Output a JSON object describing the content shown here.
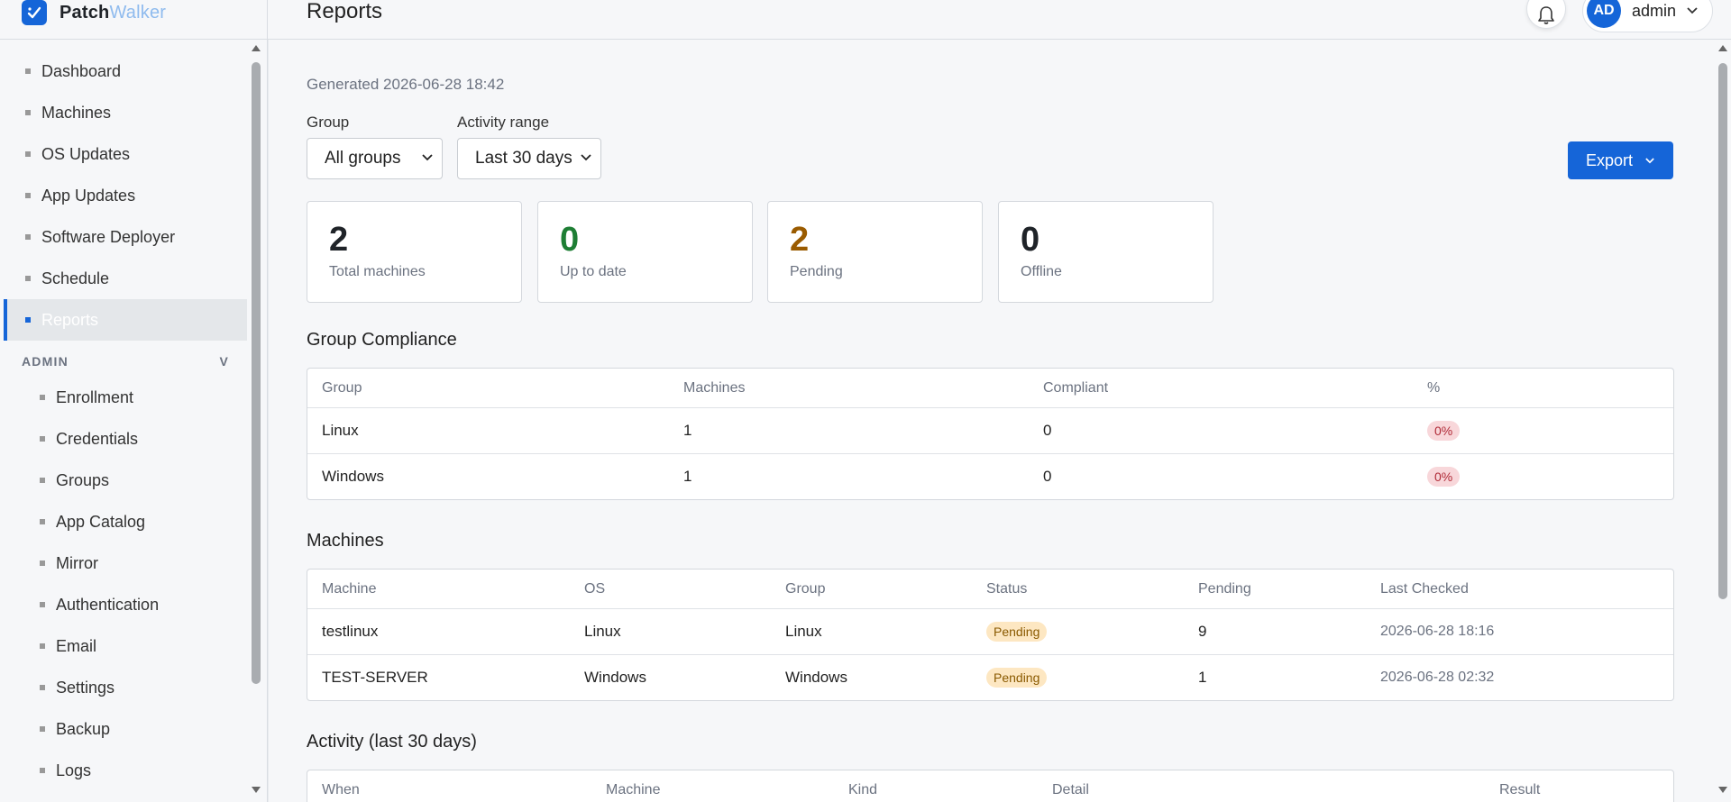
{
  "brand": {
    "part1": "Patch",
    "part2": "Walker"
  },
  "page": {
    "title": "Reports"
  },
  "header": {
    "avatar_initials": "AD",
    "user_name": "admin"
  },
  "sidebar": {
    "items": [
      {
        "label": "Dashboard"
      },
      {
        "label": "Machines"
      },
      {
        "label": "OS Updates"
      },
      {
        "label": "App Updates"
      },
      {
        "label": "Software Deployer"
      },
      {
        "label": "Schedule"
      },
      {
        "label": "Reports"
      }
    ],
    "admin_header": "ADMIN",
    "admin_toggle": "V",
    "admin_items": [
      {
        "label": "Enrollment"
      },
      {
        "label": "Credentials"
      },
      {
        "label": "Groups"
      },
      {
        "label": "App Catalog"
      },
      {
        "label": "Mirror"
      },
      {
        "label": "Authentication"
      },
      {
        "label": "Email"
      },
      {
        "label": "Settings"
      },
      {
        "label": "Backup"
      },
      {
        "label": "Logs"
      }
    ]
  },
  "main": {
    "generated": "Generated 2026-06-28 18:42",
    "filters": {
      "group_label": "Group",
      "group_value": "All groups",
      "activity_label": "Activity range",
      "activity_value": "Last 30 days"
    },
    "export_label": "Export",
    "stats": [
      {
        "value": "2",
        "label": "Total machines",
        "color": "#1f2328"
      },
      {
        "value": "0",
        "label": "Up to date",
        "color": "#1e7e34"
      },
      {
        "value": "2",
        "label": "Pending",
        "color": "#9a5b00"
      },
      {
        "value": "0",
        "label": "Offline",
        "color": "#1f2328"
      }
    ],
    "compliance": {
      "title": "Group Compliance",
      "columns": [
        "Group",
        "Machines",
        "Compliant",
        "%"
      ],
      "rows": [
        {
          "group": "Linux",
          "machines": "1",
          "compliant": "0",
          "pct": "0%"
        },
        {
          "group": "Windows",
          "machines": "1",
          "compliant": "0",
          "pct": "0%"
        }
      ]
    },
    "machines": {
      "title": "Machines",
      "columns": [
        "Machine",
        "OS",
        "Group",
        "Status",
        "Pending",
        "Last Checked"
      ],
      "rows": [
        {
          "machine": "testlinux",
          "os": "Linux",
          "group": "Linux",
          "status": "Pending",
          "pending": "9",
          "last_checked": "2026-06-28 18:16"
        },
        {
          "machine": "TEST-SERVER",
          "os": "Windows",
          "group": "Windows",
          "status": "Pending",
          "pending": "1",
          "last_checked": "2026-06-28 02:32"
        }
      ]
    },
    "activity": {
      "title": "Activity (last 30 days)",
      "columns": [
        "When",
        "Machine",
        "Kind",
        "Detail",
        "Result"
      ]
    }
  }
}
